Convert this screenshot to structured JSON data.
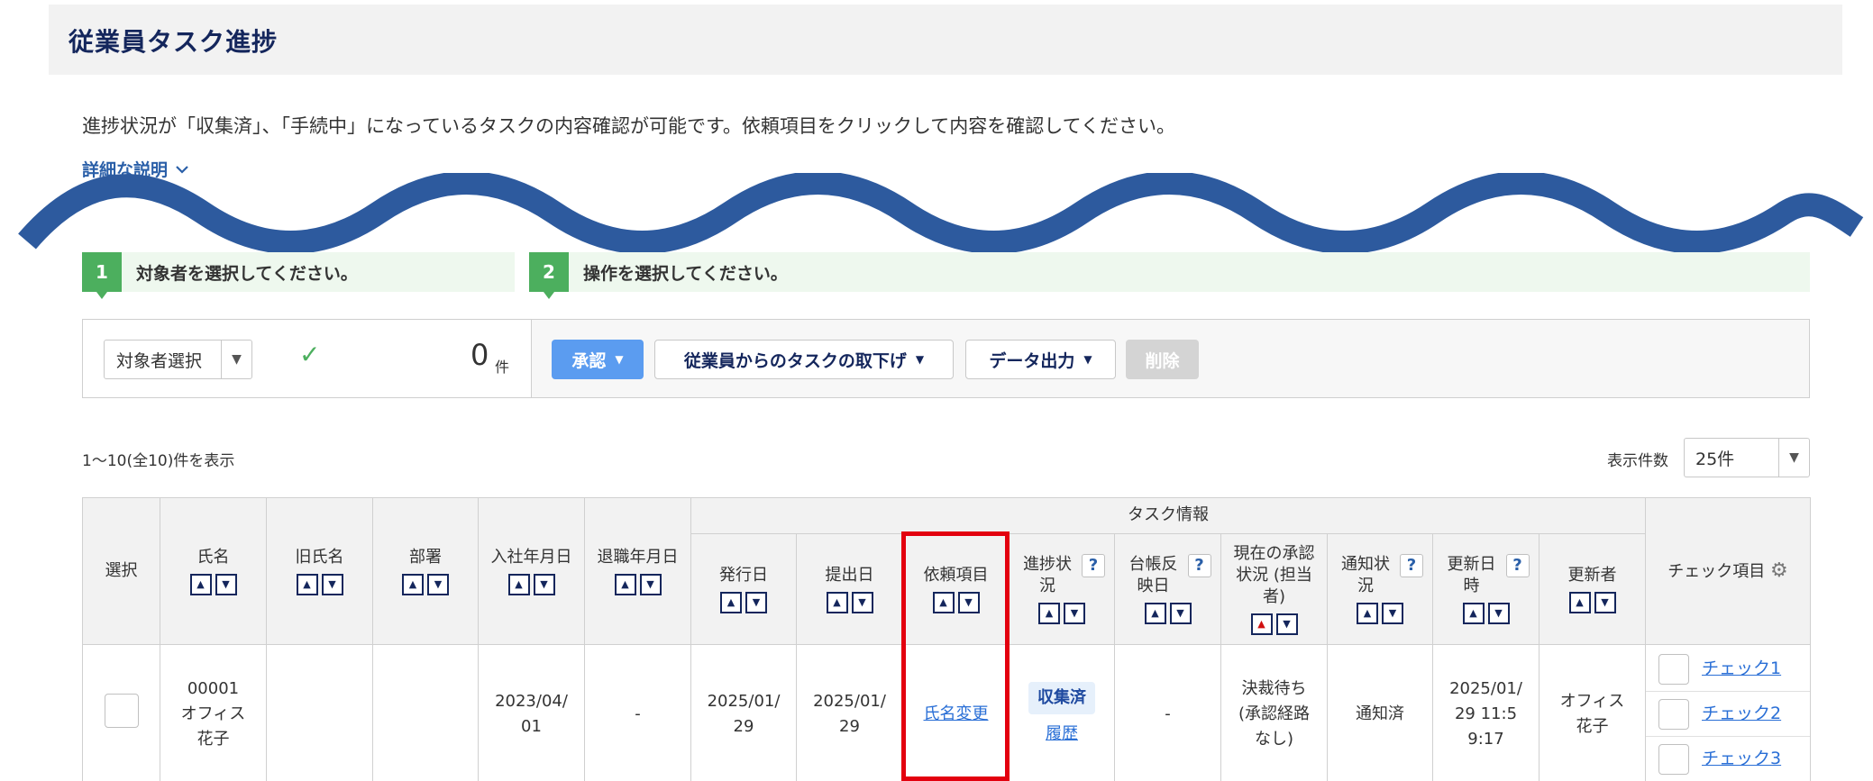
{
  "page": {
    "title": "従業員タスク進捗"
  },
  "description": "進捗状況が「収集済」、「手続中」になっているタスクの内容確認が可能です。依頼項目をクリックして内容を確認してください。",
  "detail_link": "詳細な説明",
  "steps": [
    {
      "num": "1",
      "label": "対象者を選択してください。"
    },
    {
      "num": "2",
      "label": "操作を選択してください。"
    }
  ],
  "action_bar": {
    "target_select": "対象者選択",
    "count": "0",
    "count_unit": "件",
    "approve": "承認",
    "withdraw": "従業員からのタスクの取下げ",
    "export": "データ出力",
    "delete": "削除"
  },
  "list": {
    "result_count": "1〜10(全10)件を表示",
    "per_page_label": "表示件数",
    "per_page_value": "25件"
  },
  "table": {
    "group_header": "タスク情報",
    "headers": {
      "select": "選択",
      "name": "氏名",
      "old_name": "旧氏名",
      "department": "部署",
      "hire_date": "入社年月日",
      "leave_date": "退職年月日",
      "issue_date": "発行日",
      "submit_date": "提出日",
      "request_item": "依頼項目",
      "progress": "進捗状況",
      "ledger": "台帳反映日",
      "approval": "現在の承認状況 (担当者)",
      "notice": "通知状況",
      "updated_at": "更新日時",
      "updater": "更新者",
      "check_items": "チェック項目"
    },
    "rows": [
      {
        "employee_no": "00001",
        "name": "オフィス 花子",
        "old_name": "",
        "department": "",
        "hire_date": "2023/04/01",
        "leave_date": "-",
        "issue_date": "2025/01/29",
        "submit_date": "2025/01/29",
        "request_item": "氏名変更",
        "progress": "収集済",
        "history": "履歴",
        "ledger": "-",
        "approval": "決裁待ち (承認経路なし)",
        "notice": "通知済",
        "updated_at": "2025/01/29 11:59:17",
        "updater": "オフィス 花子",
        "checks": [
          "チェック1",
          "チェック2",
          "チェック3"
        ]
      }
    ]
  },
  "colors": {
    "title": "#14265c",
    "link": "#2a5fa8",
    "step_green": "#4caf5e",
    "approve_blue": "#5b9cf0",
    "wave_blue": "#2d5a9e",
    "highlight_red": "#e3000f"
  }
}
